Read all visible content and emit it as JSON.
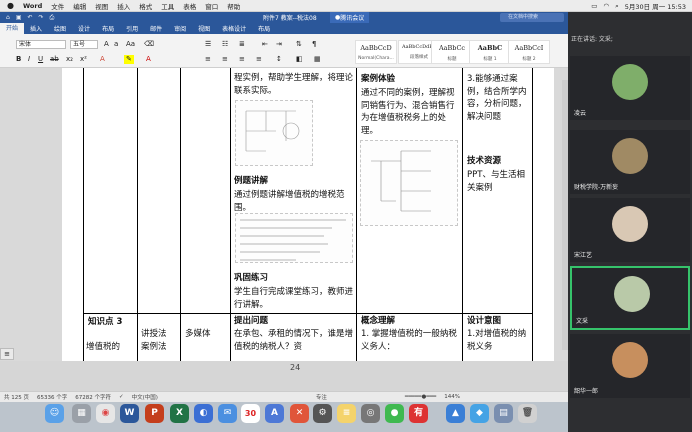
{
  "menubar": {
    "apple": "",
    "app": "Word",
    "items": [
      "文件",
      "编辑",
      "视图",
      "插入",
      "格式",
      "工具",
      "表格",
      "窗口",
      "帮助"
    ],
    "right_status": "5月30日 周一  15:53"
  },
  "word_toolbar": {
    "doc_title": "附件7 教案--税法08",
    "meeting": "腾讯会议",
    "search_placeholder": "在文档中搜索"
  },
  "tabs": [
    "开始",
    "插入",
    "绘图",
    "设计",
    "布局",
    "引用",
    "邮件",
    "审阅",
    "视图",
    "表格设计",
    "布局"
  ],
  "active_tab": "开始",
  "font": {
    "name": "宋体",
    "size": "五号"
  },
  "styles": [
    {
      "sample": "AaBbCcD",
      "name": "Normal(Chara..."
    },
    {
      "sample": "AaBbCcDdEe",
      "name": "段落样式"
    },
    {
      "sample": "AaBbCc",
      "name": "标题"
    },
    {
      "sample": "AaBbC",
      "name": "标题 1"
    },
    {
      "sample": "AaBbCcI",
      "name": "标题 2"
    }
  ],
  "document": {
    "col3_top": "程实例，帮助学生理解，将理论联系实际。",
    "example_title": "例题讲解",
    "example_text": "通过例题讲解增值税的增税范围。",
    "practice_title": "巩固练习",
    "practice_text": "学生自行完成课堂练习，教师进行讲解。",
    "case_title": "案例体验",
    "case_text": "通过不同的案例，理解视同销售行为、混合销售行为在增值税税务上的处理。",
    "col5_top": "3.能够通过案例，结合所学内容，分析问题，解决问题",
    "tech_title": "技术资源",
    "tech_text": "PPT、与生活相关案例",
    "row2_col1_title": "知识点 3",
    "row2_col1_text": "增值税的",
    "row2_col2": "讲授法\n案例法",
    "row2_col2b": "多媒体",
    "row2_col3_title": "提出问题",
    "row2_col3_text": "在承包、承租的情况下，谁是增值税的纳税人？资",
    "row2_col4_title": "概念理解",
    "row2_col4_text": "1. 掌握增值税的一般纳税义务人：",
    "row2_col5_title": "设计意图",
    "row2_col5_text": "1.对增值税的纳税义务",
    "page_number": "24"
  },
  "statusbar": {
    "page": "共 125 页",
    "words": "65336 个字",
    "words2": "67282 个字符",
    "lang": "中文(中国)",
    "focus": "专注",
    "zoom": "144%"
  },
  "meeting_panel": {
    "speaking": "正在讲话: 文采;",
    "participants": [
      {
        "name": "凌云",
        "color": "#7fae6a"
      },
      {
        "name": "财税学院-万新妄",
        "color": "#a08a64"
      },
      {
        "name": "宋江艺",
        "color": "#d9c8b4"
      },
      {
        "name": "文采",
        "color": "#b9c9a8"
      },
      {
        "name": "韶华一郎",
        "color": "#c78f5e"
      }
    ],
    "selected": "文采"
  },
  "dock": {
    "calendar_day": "30"
  }
}
